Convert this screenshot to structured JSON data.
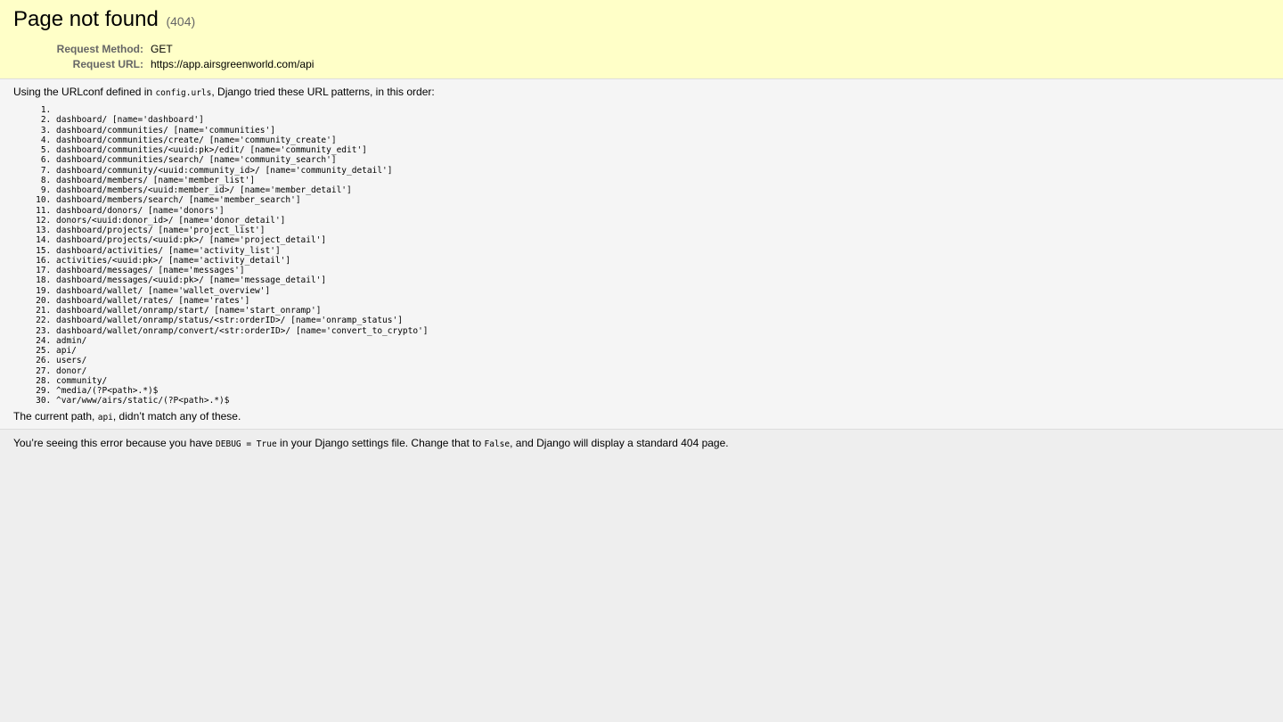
{
  "header": {
    "title": "Page not found",
    "status": "(404)",
    "request_method_label": "Request Method:",
    "request_method": "GET",
    "request_url_label": "Request URL:",
    "request_url": "https://app.airsgreenworld.com/api"
  },
  "info": {
    "intro_prefix": "Using the URLconf defined in ",
    "urlconf": "config.urls",
    "intro_suffix": ", Django tried these URL patterns, in this order:",
    "patterns": [
      "",
      "dashboard/ [name='dashboard']",
      "dashboard/communities/ [name='communities']",
      "dashboard/communities/create/ [name='community_create']",
      "dashboard/communities/<uuid:pk>/edit/ [name='community_edit']",
      "dashboard/communities/search/ [name='community_search']",
      "dashboard/community/<uuid:community_id>/ [name='community_detail']",
      "dashboard/members/ [name='member_list']",
      "dashboard/members/<uuid:member_id>/ [name='member_detail']",
      "dashboard/members/search/ [name='member_search']",
      "dashboard/donors/ [name='donors']",
      "donors/<uuid:donor_id>/ [name='donor_detail']",
      "dashboard/projects/ [name='project_list']",
      "dashboard/projects/<uuid:pk>/ [name='project_detail']",
      "dashboard/activities/ [name='activity_list']",
      "activities/<uuid:pk>/ [name='activity_detail']",
      "dashboard/messages/ [name='messages']",
      "dashboard/messages/<uuid:pk>/ [name='message_detail']",
      "dashboard/wallet/ [name='wallet_overview']",
      "dashboard/wallet/rates/ [name='rates']",
      "dashboard/wallet/onramp/start/ [name='start_onramp']",
      "dashboard/wallet/onramp/status/<str:orderID>/ [name='onramp_status']",
      "dashboard/wallet/onramp/convert/<str:orderID>/ [name='convert_to_crypto']",
      "admin/",
      "api/",
      "users/",
      "donor/",
      "community/",
      "^media/(?P<path>.*)$",
      "^var/www/airs/static/(?P<path>.*)$"
    ],
    "current_path_prefix": "The current path, ",
    "current_path": "api",
    "current_path_suffix": ", didn’t match any of these."
  },
  "explanation": {
    "prefix": "You’re seeing this error because you have ",
    "debug_setting": "DEBUG = True",
    "middle": " in your Django settings file. Change that to ",
    "false_value": "False",
    "suffix": ", and Django will display a standard 404 page."
  }
}
